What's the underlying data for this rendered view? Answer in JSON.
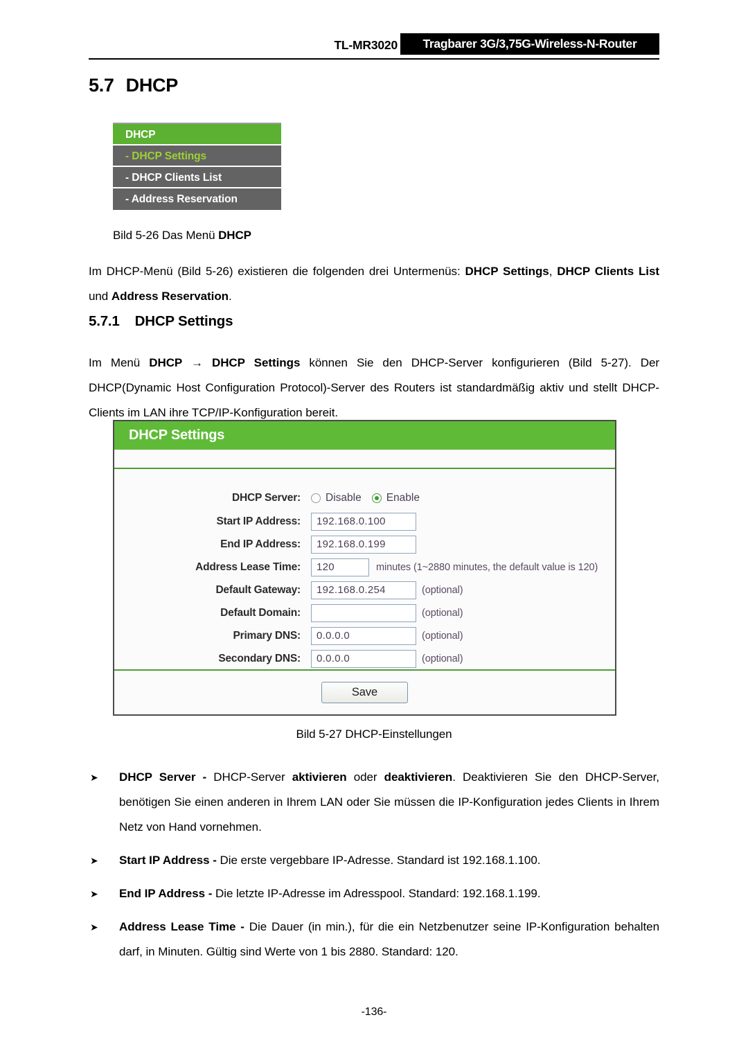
{
  "header": {
    "model": "TL-MR3020",
    "product_tag": "Tragbarer 3G/3,75G-Wireless-N-Router"
  },
  "section": {
    "number": "5.7",
    "title": "DHCP"
  },
  "menu_screenshot": {
    "header_label": "DHCP",
    "items": [
      {
        "label": "- DHCP Settings",
        "active": true
      },
      {
        "label": "- DHCP Clients List",
        "active": false
      },
      {
        "label": "- Address Reservation",
        "active": false
      }
    ]
  },
  "captions": {
    "figure_526_prefix": "Bild 5-26 Das Menü ",
    "figure_526_bold": "DHCP",
    "figure_527": "Bild 5-27 DHCP-Einstellungen"
  },
  "intro_paragraph": {
    "part1": "Im DHCP-Menü (Bild 5-26) existieren die folgenden drei Untermenüs: ",
    "bold1": "DHCP Settings",
    "part2": ", ",
    "bold2": "DHCP Clients List",
    "part3": " und ",
    "bold3": "Address Reservation",
    "part4": "."
  },
  "subsection": {
    "number": "5.7.1",
    "title": "DHCP Settings"
  },
  "settings_paragraph": {
    "part1": "Im Menü ",
    "bold1": "DHCP",
    "arrow": " → ",
    "bold2": "DHCP Settings",
    "part2": " können Sie den DHCP-Server konfigurieren (Bild 5-27). Der DHCP(Dynamic Host Configuration Protocol)-Server des Routers ist standardmäßig aktiv und stellt DHCP-Clients im LAN ihre TCP/IP-Konfiguration bereit."
  },
  "form_screenshot": {
    "title": "DHCP Settings",
    "dhcp_server": {
      "label": "DHCP Server:",
      "options": [
        {
          "label": "Disable",
          "selected": false
        },
        {
          "label": "Enable",
          "selected": true
        }
      ]
    },
    "fields": [
      {
        "label": "Start IP Address:",
        "value": "192.168.0.100",
        "hint": ""
      },
      {
        "label": "End IP Address:",
        "value": "192.168.0.199",
        "hint": ""
      },
      {
        "label": "Address Lease Time:",
        "value": "120",
        "hint": "minutes (1~2880 minutes, the default value is 120)"
      },
      {
        "label": "Default Gateway:",
        "value": "192.168.0.254",
        "hint": "(optional)"
      },
      {
        "label": "Default Domain:",
        "value": "",
        "hint": "(optional)"
      },
      {
        "label": "Primary DNS:",
        "value": "0.0.0.0",
        "hint": "(optional)"
      },
      {
        "label": "Secondary DNS:",
        "value": "0.0.0.0",
        "hint": "(optional)"
      }
    ],
    "save_label": "Save"
  },
  "bullets": [
    {
      "marker": "➤",
      "term": "DHCP Server",
      "dash": " - ",
      "text_parts": [
        {
          "t": "DHCP-Server ",
          "b": false
        },
        {
          "t": "aktivieren",
          "b": true
        },
        {
          "t": " oder ",
          "b": false
        },
        {
          "t": "deaktivieren",
          "b": true
        },
        {
          "t": ". Deaktivieren Sie den DHCP-Server, benötigen Sie einen anderen in Ihrem LAN oder Sie müssen die IP-Konfiguration jedes Clients in Ihrem Netz von Hand vornehmen.",
          "b": false
        }
      ]
    },
    {
      "marker": "➤",
      "term": "Start IP Address",
      "dash": " - ",
      "text_parts": [
        {
          "t": "Die erste vergebbare IP-Adresse. Standard ist 192.168.1.100.",
          "b": false
        }
      ]
    },
    {
      "marker": "➤",
      "term": "End IP Address",
      "dash": " - ",
      "text_parts": [
        {
          "t": "Die letzte IP-Adresse im Adresspool. Standard: 192.168.1.199.",
          "b": false
        }
      ]
    },
    {
      "marker": "➤",
      "term": "Address Lease Time",
      "dash": " - ",
      "text_parts": [
        {
          "t": "Die Dauer (in min.), für die ein Netzbenutzer seine IP-Konfiguration behalten darf, in Minuten. Gültig sind Werte von 1 bis 2880. Standard: 120.",
          "b": false
        }
      ]
    }
  ],
  "footer": {
    "page_number": "-136-"
  },
  "colors": {
    "menu_header_green": "#5cb032",
    "menu_item_gray": "#636363",
    "menu_active_text": "#9dd134",
    "form_title_green": "#5fbb37",
    "separator_green": "#4f9b36",
    "radio_green": "#3f9b32"
  }
}
